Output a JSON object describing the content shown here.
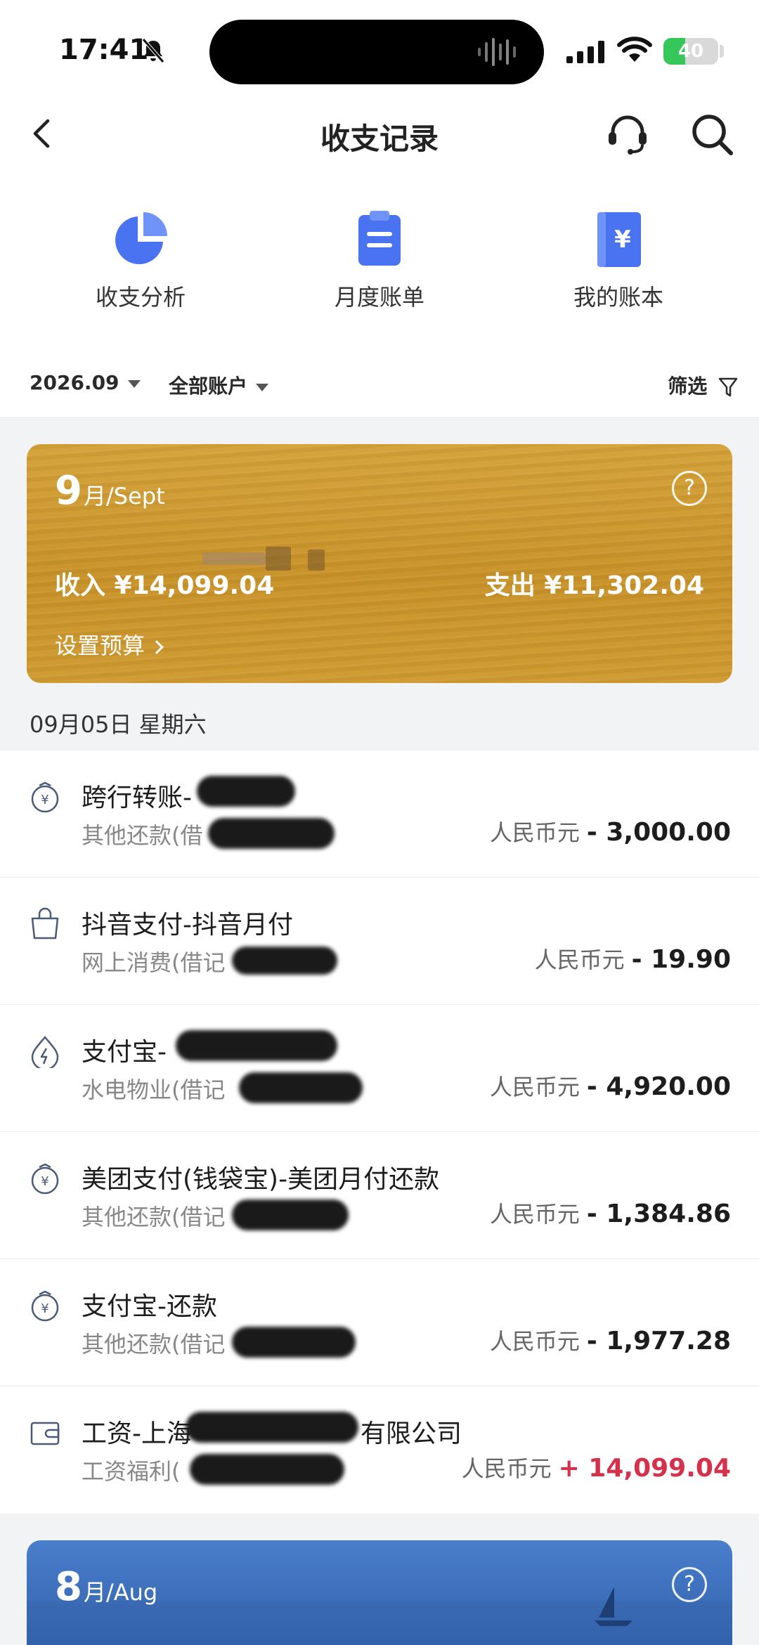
{
  "status_bar": {
    "time": "17:41",
    "battery": "40",
    "battery_level": 0.4
  },
  "nav": {
    "title": "收支记录"
  },
  "shortcuts": [
    {
      "label": "收支分析",
      "icon": "pie-chart-icon"
    },
    {
      "label": "月度账单",
      "icon": "clipboard-icon"
    },
    {
      "label": "我的账本",
      "icon": "ledger-book-icon"
    }
  ],
  "filters": {
    "period": "2026.09",
    "account": "全部账户",
    "filter_label": "筛选"
  },
  "month_card": {
    "month_num": "9",
    "month_rest": "月/Sept",
    "income": "收入 ¥14,099.04",
    "expense": "支出 ¥11,302.04",
    "budget": "设置预算",
    "help": "?",
    "color": "#cf9a30"
  },
  "date_header": "09月05日 星期六",
  "transactions": [
    {
      "title": "跨行转账-",
      "subtitle": "其他还款(借",
      "currency": "人民币元",
      "amount": "- 3,000.00",
      "icon": "yuan-coin-icon",
      "type": "expense"
    },
    {
      "title": "抖音支付-抖音月付",
      "subtitle": "网上消费(借记",
      "currency": "人民币元",
      "amount": "- 19.90",
      "icon": "shopping-bag-icon",
      "type": "expense"
    },
    {
      "title": "支付宝-",
      "subtitle": "水电物业(借记",
      "currency": "人民币元",
      "amount": "- 4,920.00",
      "icon": "utility-bolt-icon",
      "type": "expense"
    },
    {
      "title": "美团支付(钱袋宝)-美团月付还款",
      "subtitle": "其他还款(借记",
      "currency": "人民币元",
      "amount": "- 1,384.86",
      "icon": "yuan-coin-icon",
      "type": "expense"
    },
    {
      "title": "支付宝-还款",
      "subtitle": "其他还款(借记",
      "currency": "人民币元",
      "amount": "- 1,977.28",
      "icon": "yuan-coin-icon",
      "type": "expense"
    },
    {
      "title": "工资-上海",
      "title_tail": "有限公司",
      "subtitle": "工资福利(",
      "currency": "人民币元",
      "amount": "+ 14,099.04",
      "icon": "wallet-icon",
      "type": "income"
    }
  ],
  "next_month_card": {
    "month_num": "8",
    "month_rest": "月/Aug",
    "help": "?",
    "color": "#3d6fbb"
  },
  "colors": {
    "accent_blue": "#4a73f2",
    "income_red": "#d6314b"
  }
}
